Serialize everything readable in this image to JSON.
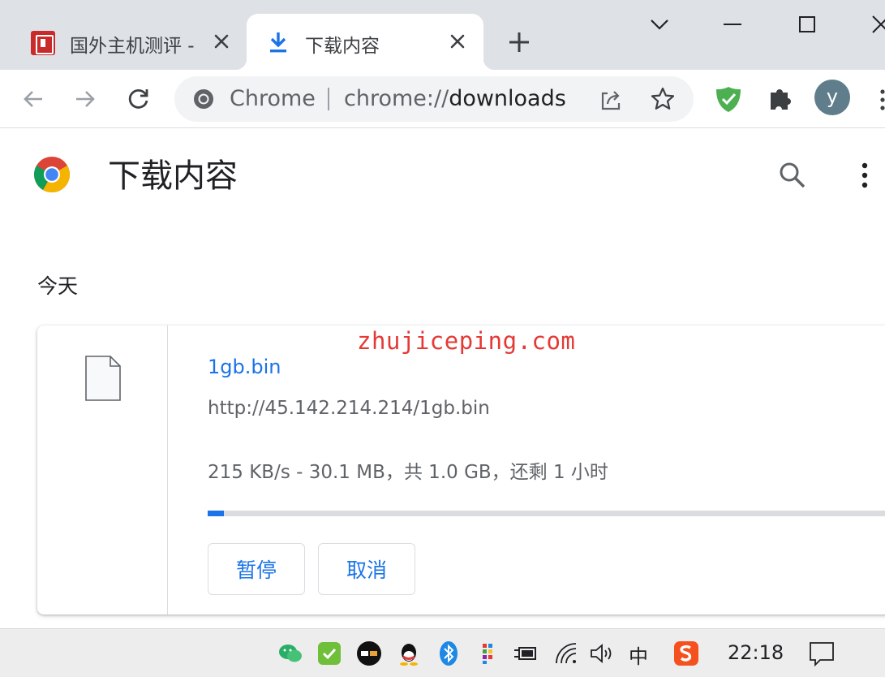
{
  "tabs": [
    {
      "title": "国外主机测评 - ",
      "favicon": "site-seal-icon"
    },
    {
      "title": "下载内容",
      "favicon": "download-icon",
      "active": true
    }
  ],
  "toolbar": {
    "chip_label": "Chrome",
    "url_scheme": "chrome://",
    "url_path": "downloads",
    "avatar_letter": "y"
  },
  "page": {
    "title": "下载内容",
    "section_date": "今天"
  },
  "download": {
    "file_name": "1gb.bin",
    "url": "http://45.142.214.214/1gb.bin",
    "status": "215 KB/s - 30.1 MB，共 1.0 GB，还剩 1 小时",
    "progress_percent": 2.4,
    "pause_label": "暂停",
    "cancel_label": "取消"
  },
  "watermark": "zhujiceping.com",
  "taskbar": {
    "ime": "中",
    "clock": "22:18",
    "tray_icons": [
      "wechat-icon",
      "check-shield-icon",
      "app-badge-icon",
      "qq-icon",
      "bluetooth-icon",
      "color-grid-icon",
      "power-plug-icon",
      "wifi-icon",
      "volume-icon",
      "sogou-icon",
      "notification-icon"
    ]
  },
  "colors": {
    "accent": "#1a73e8",
    "tabstrip": "#dee1e6",
    "watermark": "#e53935"
  }
}
